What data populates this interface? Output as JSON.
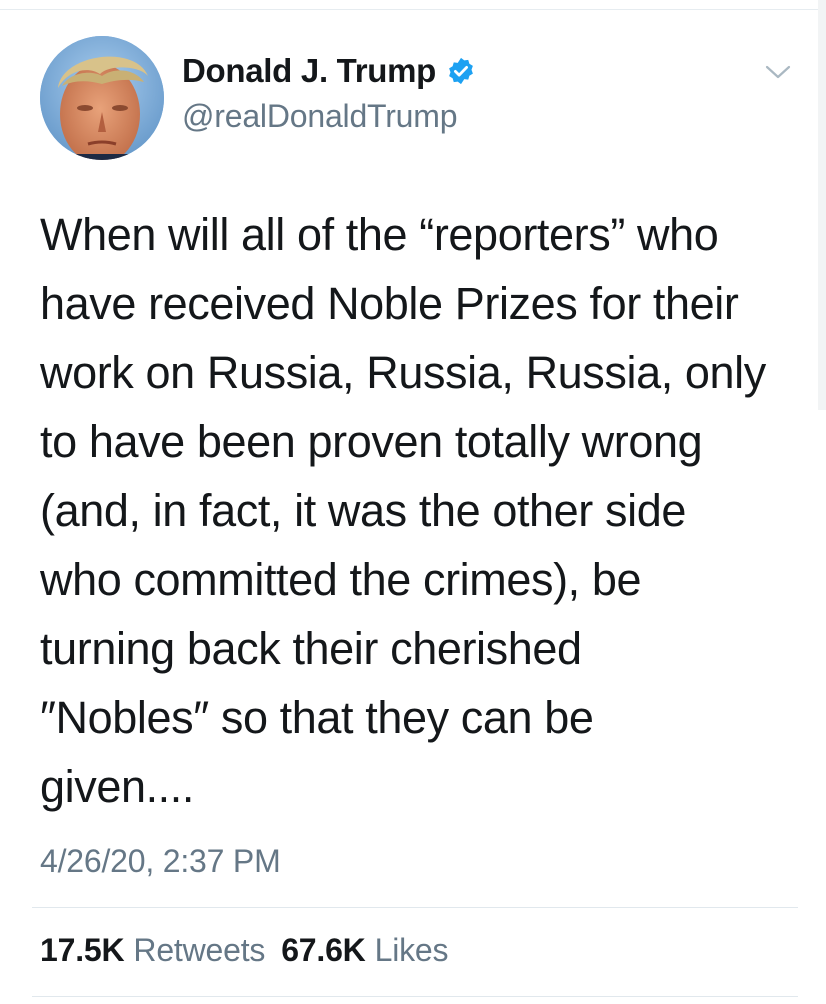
{
  "author": {
    "display_name": "Donald J. Trump",
    "handle": "@realDonaldTrump",
    "verified": true,
    "avatar_icon": "profile-photo"
  },
  "tweet": {
    "text_lines": [
      "When will all of the “reporters” who",
      "have received Noble Prizes for their",
      "work on Russia, Russia, Russia, only",
      "to have been proven totally wrong",
      "(and, in fact, it was the other side",
      "who committed the crimes), be",
      "turning back their cherished",
      "″Nobles″ so that they can be",
      "given...."
    ],
    "timestamp": "4/26/20, 2:37 PM"
  },
  "stats": {
    "retweets_count": "17.5K",
    "retweets_label": "Retweets",
    "likes_count": "67.6K",
    "likes_label": "Likes"
  },
  "icons": {
    "verified": "verified-badge-icon",
    "menu": "chevron-down-icon"
  },
  "colors": {
    "primary_text": "#14171a",
    "secondary_text": "#657786",
    "verified_blue": "#1da1f2",
    "divider": "#e1e8ed"
  }
}
